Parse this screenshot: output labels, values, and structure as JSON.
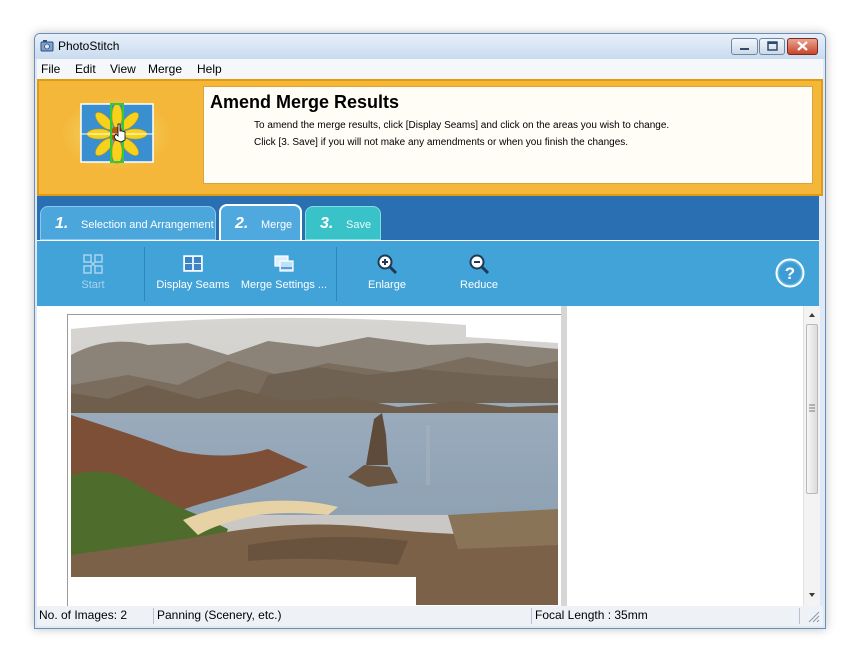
{
  "window": {
    "title": "PhotoStitch"
  },
  "menu": {
    "items": [
      {
        "label": "File"
      },
      {
        "label": "Edit"
      },
      {
        "label": "View"
      },
      {
        "label": "Merge"
      },
      {
        "label": "Help"
      }
    ]
  },
  "banner": {
    "title": "Amend Merge Results",
    "line1": "To amend the merge results, click [Display Seams] and click on the areas you wish to change.",
    "line2": "Click [3. Save] if you will not make any amendments or when you finish the changes."
  },
  "tabs": [
    {
      "number": "1.",
      "label": "Selection and Arrangement"
    },
    {
      "number": "2.",
      "label": "Merge"
    },
    {
      "number": "3.",
      "label": "Save"
    }
  ],
  "toolbar": {
    "start_label": "Start",
    "display_seams_label": "Display Seams",
    "merge_settings_label": "Merge Settings ...",
    "enlarge_label": "Enlarge",
    "reduce_label": "Reduce"
  },
  "status": {
    "images": "No. of Images: 2",
    "mode": "Panning (Scenery, etc.)",
    "focal": "Focal Length : 35mm"
  },
  "colors": {
    "banner": "#f4b73a",
    "tab_strip": "#2a6fb1",
    "toolbar": "#41a3d8",
    "save_tab": "#39c3c8"
  },
  "icons": {
    "start": "start-icon",
    "display_seams": "display-seams-icon",
    "merge_settings": "merge-settings-icon",
    "enlarge": "zoom-in-icon",
    "reduce": "zoom-out-icon",
    "help": "help-icon"
  }
}
